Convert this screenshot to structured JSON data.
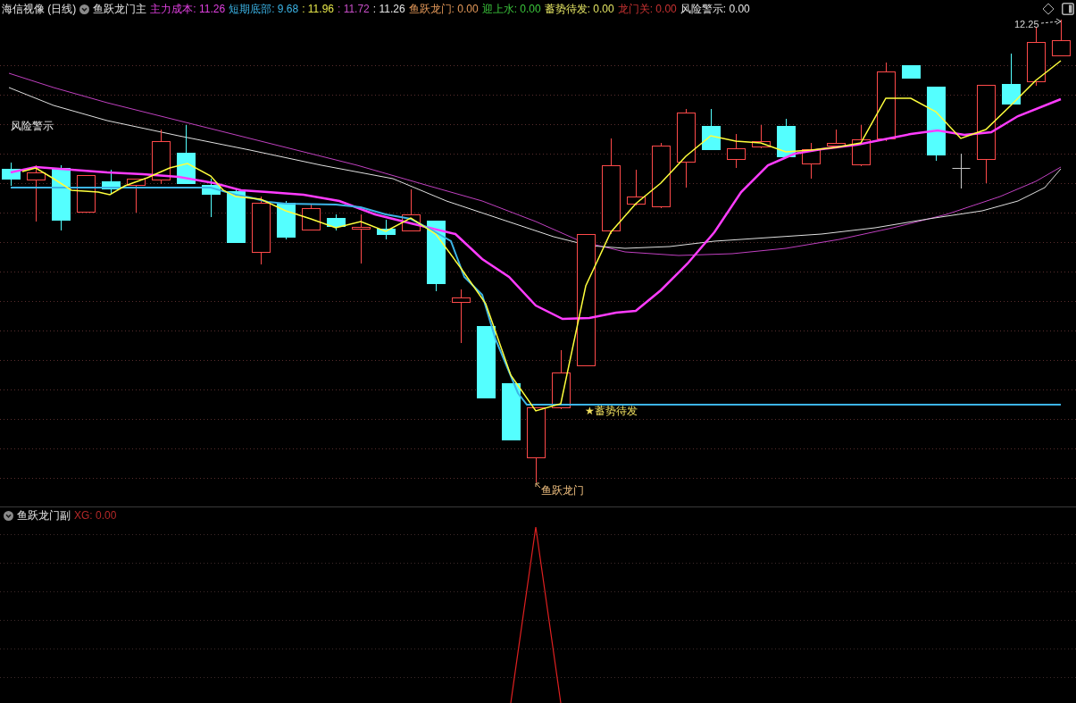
{
  "header": {
    "symbol": "海信视像 (日线)",
    "indicator": "鱼跃龙门主",
    "legend": [
      {
        "text": "主力成本: 11.26",
        "color": "#e040e0"
      },
      {
        "text": "短期底部: 9.68",
        "color": "#3cb4e6"
      },
      {
        "text": ": 11.96",
        "color": "#e6e64a"
      },
      {
        "text": ": 11.72",
        "color": "#c84ec8"
      },
      {
        "text": ": 11.26",
        "color": "#e6e6e6"
      },
      {
        "text": "鱼跃龙门: 0.00",
        "color": "#e69a5a"
      },
      {
        "text": "迎上水: 0.00",
        "color": "#3cc83c"
      },
      {
        "text": "蓄势待发: 0.00",
        "color": "#e6e664"
      },
      {
        "text": "龙门关: 0.00",
        "color": "#c83232"
      },
      {
        "text": "风险警示: 0.00",
        "color": "#e6e6e6"
      }
    ]
  },
  "main_chart": {
    "price_marker": "12.25",
    "annotations": [
      {
        "kind": "label",
        "text": "风险警示"
      },
      {
        "kind": "star",
        "text": "★蓄势待发"
      },
      {
        "kind": "pointer",
        "text": "鱼跃龙门"
      }
    ]
  },
  "sub_panel": {
    "indicator": "鱼跃龙门副",
    "legend": [
      {
        "text": "XG: 0.00",
        "color": "#b42828"
      }
    ]
  }
}
